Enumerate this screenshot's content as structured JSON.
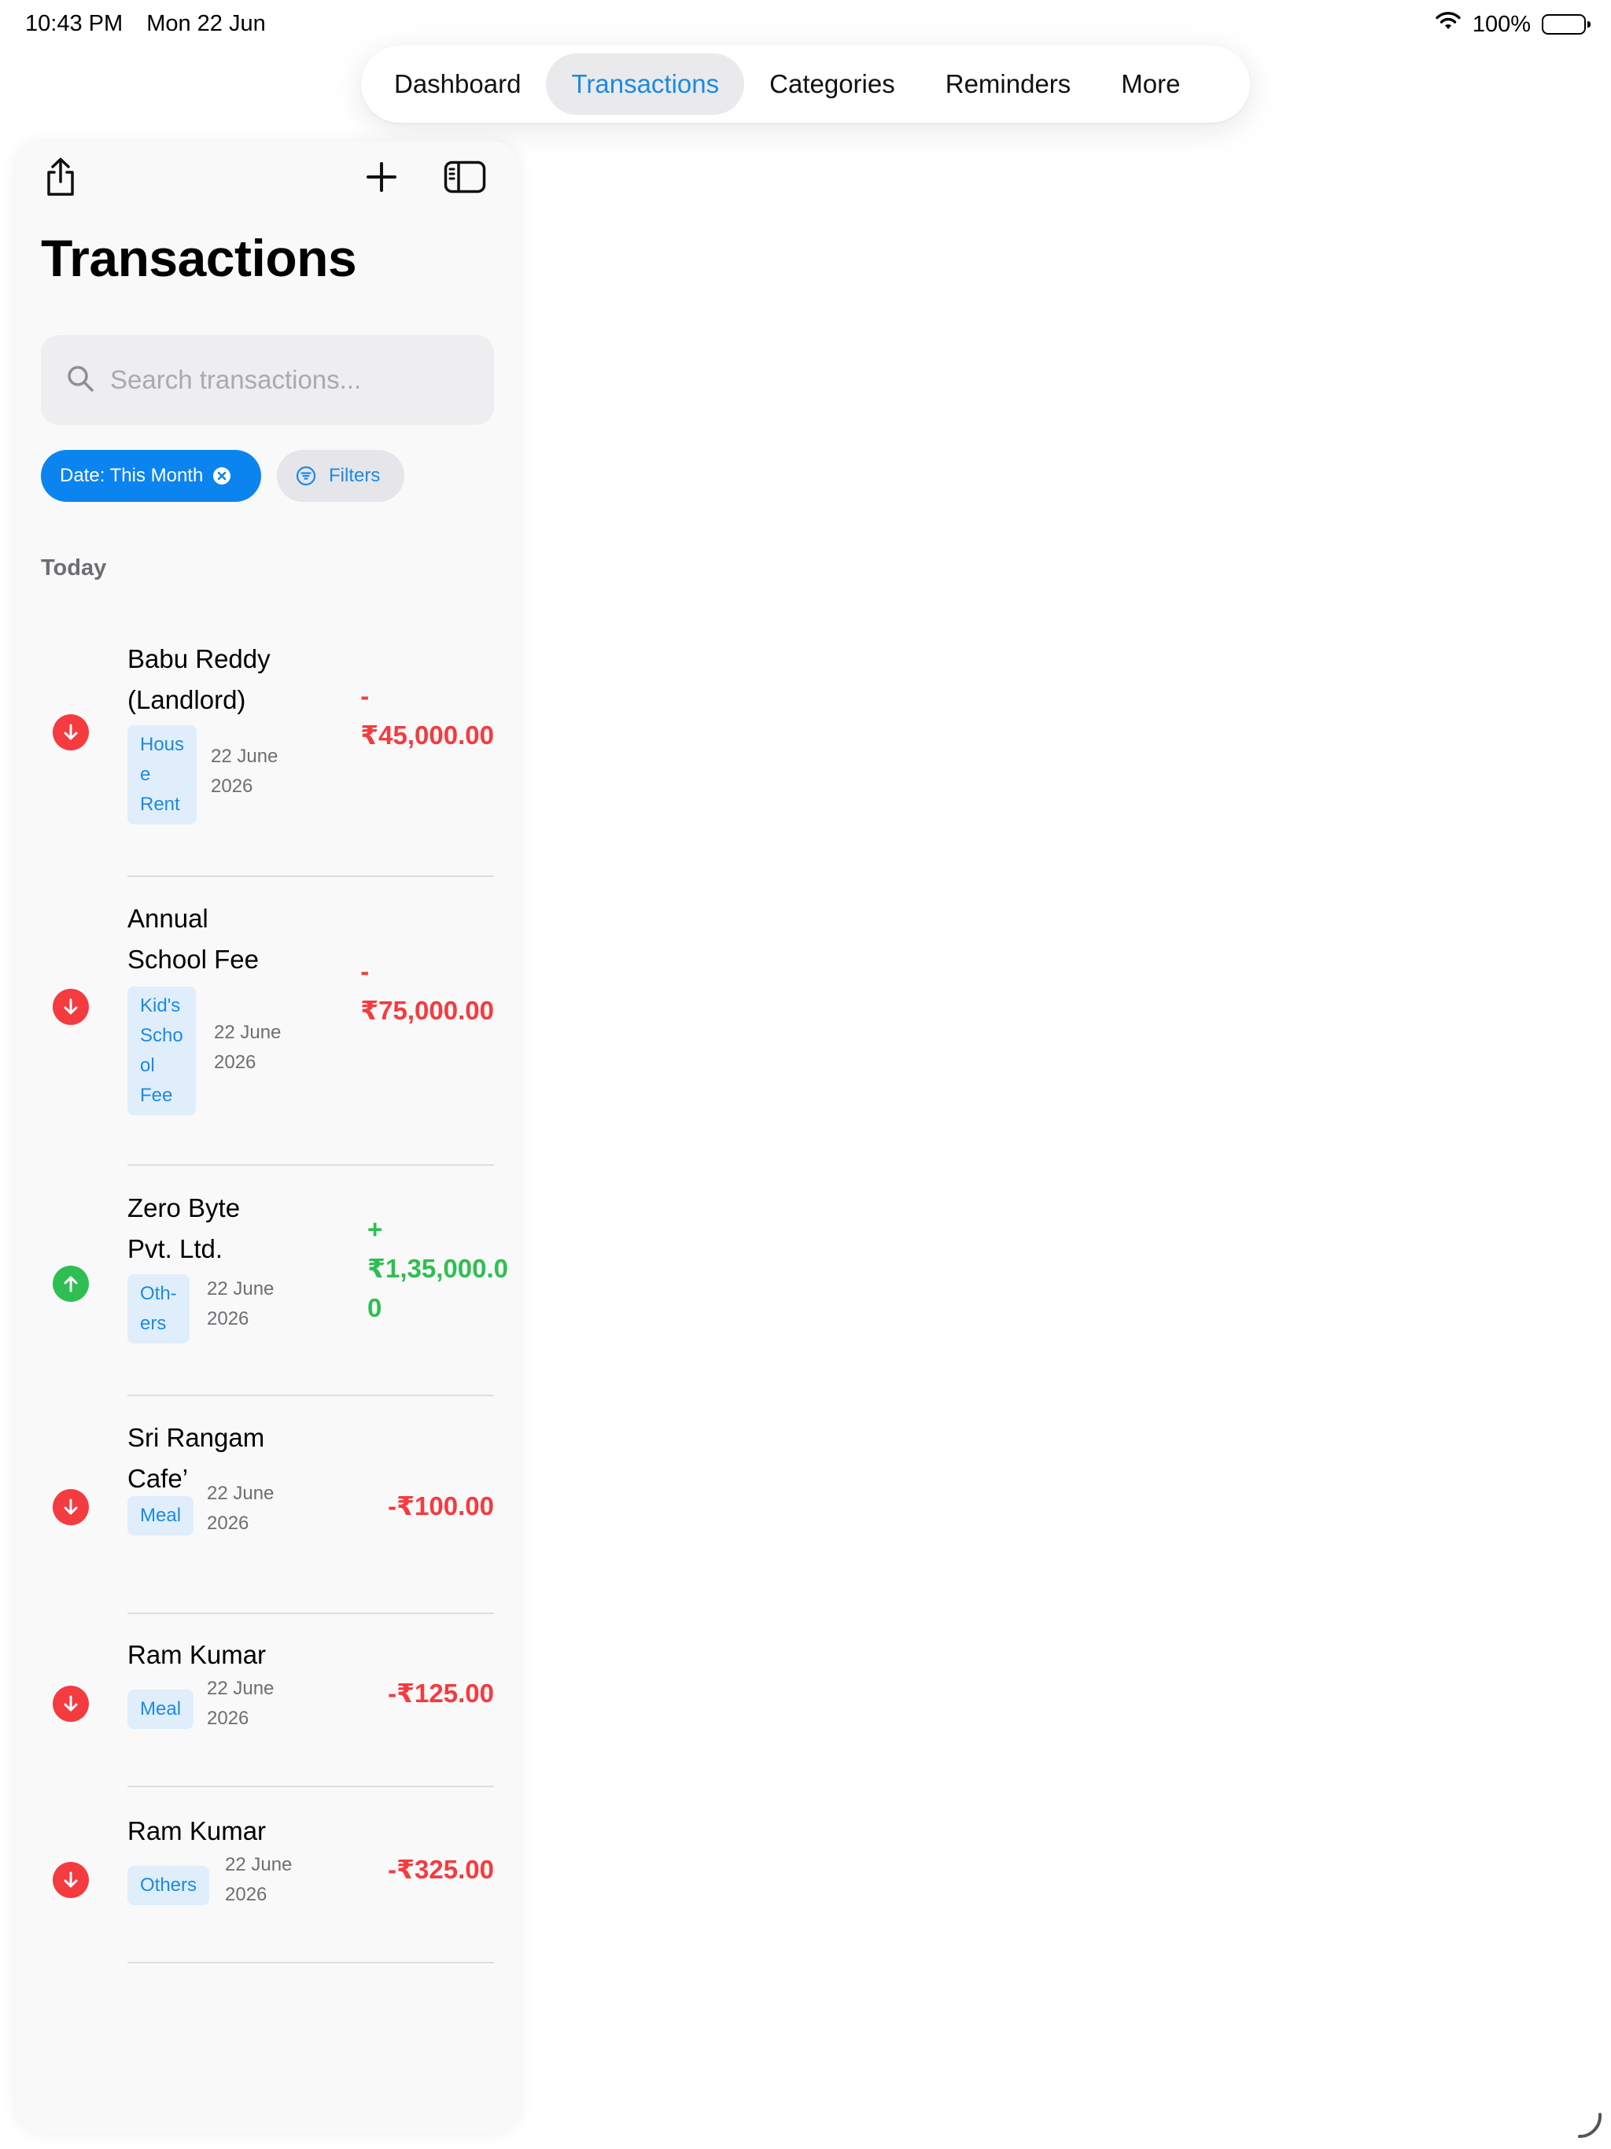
{
  "status_bar": {
    "time": "10:43 PM",
    "date": "Mon 22 Jun",
    "battery": "100%"
  },
  "tabs": [
    {
      "label": "Dashboard",
      "active": false
    },
    {
      "label": "Transactions",
      "active": true
    },
    {
      "label": "Categories",
      "active": false
    },
    {
      "label": "Reminders",
      "active": false
    },
    {
      "label": "More",
      "active": false
    }
  ],
  "toolbar": {
    "share_icon": "share-icon",
    "add_icon": "plus-icon",
    "sidebar_icon": "sidebar-toggle-icon"
  },
  "page_title": "Transactions",
  "search": {
    "placeholder": "Search transactions...",
    "value": ""
  },
  "chips": {
    "date_label": "Date: This Month",
    "filters_label": "Filters"
  },
  "section_label": "Today",
  "transactions": [
    {
      "name": "Babu Reddy\n(Landlord)",
      "tag": "Hous\ne\nRent",
      "date": "22 June\n2026",
      "amount": "-\n₹45,000.00",
      "type": "expense"
    },
    {
      "name": "Annual\nSchool Fee",
      "tag": "Kid's\nScho\nol\nFee",
      "date": "22 June\n2026",
      "amount": "-\n₹75,000.00",
      "type": "expense"
    },
    {
      "name": "Zero Byte\nPvt. Ltd.",
      "tag": "Oth-\ners",
      "date": "22 June\n2026",
      "amount": "+\n₹1,35,000.0\n0",
      "type": "income"
    },
    {
      "name": "Sri Rangam\nCafe’",
      "tag": "Meal",
      "date": "22 June\n2026",
      "amount": "-₹100.00",
      "type": "expense"
    },
    {
      "name": "Ram Kumar",
      "tag": "Meal",
      "date": "22 June\n2026",
      "amount": "-₹125.00",
      "type": "expense"
    },
    {
      "name": "Ram Kumar",
      "tag": "Others",
      "date": "22 June\n2026",
      "amount": "-₹325.00",
      "type": "expense"
    }
  ],
  "colors": {
    "accent": "#0b84f0",
    "expense": "#f43b40",
    "income": "#2fbe52"
  }
}
